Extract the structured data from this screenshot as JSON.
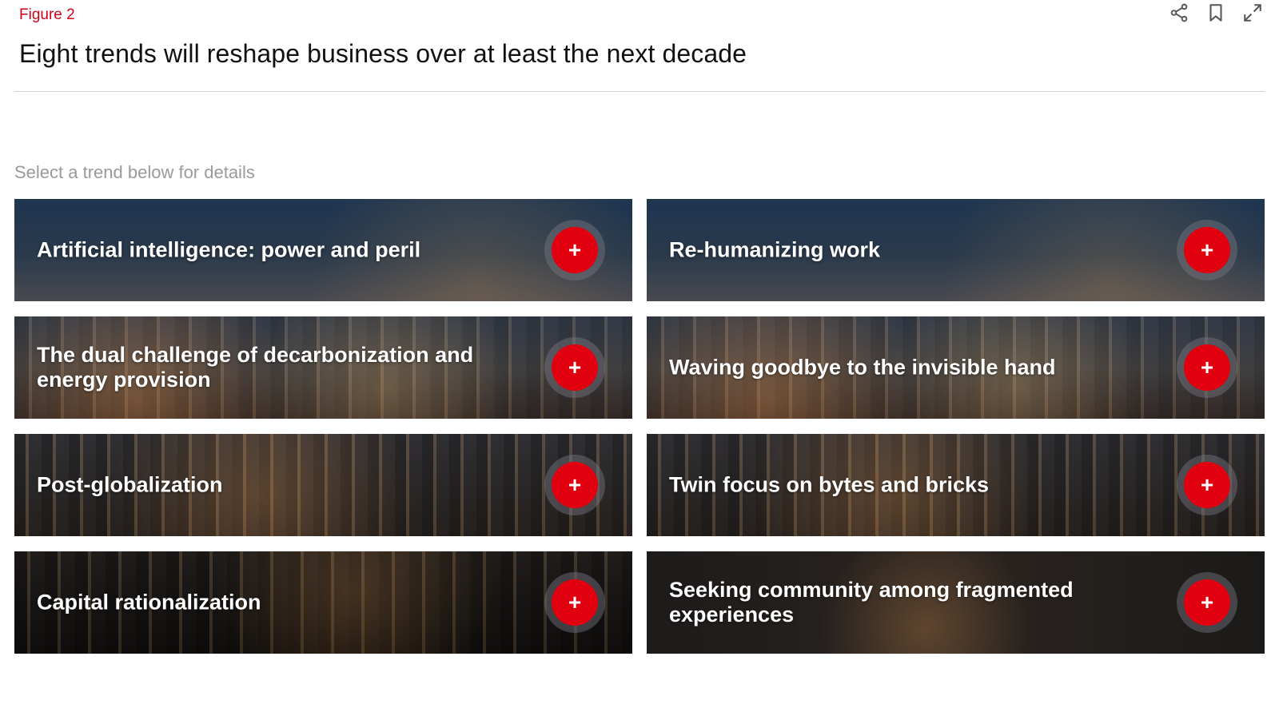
{
  "header": {
    "figure_label": "Figure 2",
    "title": "Eight trends will reshape business over at least the next decade"
  },
  "toolbar": {
    "share_icon": "share-icon",
    "bookmark_icon": "bookmark-icon",
    "expand_icon": "expand-icon"
  },
  "hint": "Select a trend below for details",
  "colors": {
    "accent": "#e0000f",
    "figure_label": "#d0021b",
    "hint": "#9a9a9a"
  },
  "trends": [
    {
      "label": "Artificial intelligence: power and peril",
      "button": "+"
    },
    {
      "label": "Re-humanizing work",
      "button": "+"
    },
    {
      "label": "The dual challenge of decarbonization and energy provision",
      "button": "+"
    },
    {
      "label": "Waving goodbye to the invisible hand",
      "button": "+"
    },
    {
      "label": "Post-globalization",
      "button": "+"
    },
    {
      "label": "Twin focus on bytes and bricks",
      "button": "+"
    },
    {
      "label": "Capital rationalization",
      "button": "+"
    },
    {
      "label": "Seeking community among fragmented experiences",
      "button": "+"
    }
  ]
}
